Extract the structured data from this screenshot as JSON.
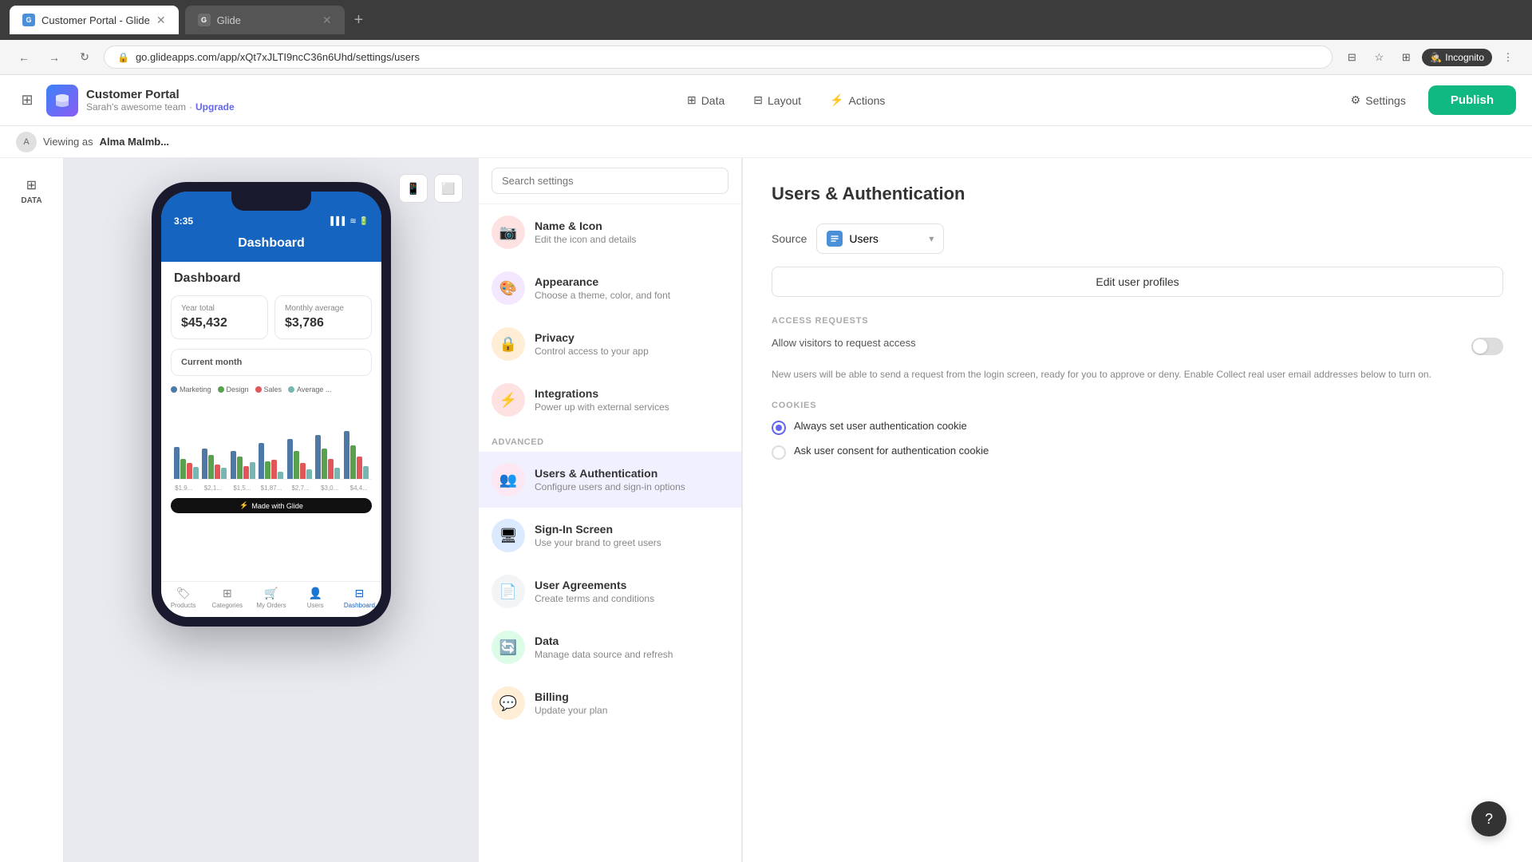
{
  "browser": {
    "tabs": [
      {
        "id": "tab1",
        "title": "Customer Portal - Glide",
        "favicon": "G",
        "active": true
      },
      {
        "id": "tab2",
        "title": "Glide",
        "favicon": "G",
        "active": false
      }
    ],
    "address": "go.glideapps.com/app/xQt7xJLTI9ncC36n6Uhd/settings/users"
  },
  "header": {
    "app_name": "Customer Portal",
    "team_name": "Sarah's awesome team",
    "upgrade_label": "Upgrade",
    "nav": [
      {
        "id": "data",
        "label": "Data",
        "icon": "⊞"
      },
      {
        "id": "layout",
        "label": "Layout",
        "icon": "⊟"
      },
      {
        "id": "actions",
        "label": "Actions",
        "icon": "⚡"
      }
    ],
    "settings_label": "Settings",
    "publish_label": "Publish"
  },
  "viewing_bar": {
    "text": "Viewing as",
    "name": "Alma Malmb..."
  },
  "device_controls": {
    "phone_icon": "📱",
    "tablet_icon": "⬜"
  },
  "phone_preview": {
    "time": "3:35",
    "screen_title": "Dashboard",
    "dashboard_title": "Dashboard",
    "stats": [
      {
        "label": "Year total",
        "value": "$45,432"
      },
      {
        "label": "Monthly average",
        "value": "$3,786"
      }
    ],
    "current_month_label": "Current month",
    "chart_legend": [
      {
        "label": "Marketing",
        "color": "#4e79a7"
      },
      {
        "label": "Design",
        "color": "#59a14f"
      },
      {
        "label": "Sales",
        "color": "#e15759"
      },
      {
        "label": "Average ...",
        "color": "#76b7b2"
      }
    ],
    "bar_data": [
      {
        "label": "$1,9...",
        "bars": [
          40,
          25,
          20,
          15
        ]
      },
      {
        "label": "$2,1...",
        "bars": [
          38,
          30,
          18,
          14
        ]
      },
      {
        "label": "$1,5...",
        "bars": [
          35,
          28,
          16,
          21
        ]
      },
      {
        "label": "$1,87...",
        "bars": [
          45,
          22,
          24,
          9
        ]
      },
      {
        "label": "$2,7...",
        "bars": [
          50,
          35,
          20,
          12
        ]
      },
      {
        "label": "$3,0...",
        "bars": [
          55,
          38,
          25,
          14
        ]
      },
      {
        "label": "$4,4...",
        "bars": [
          60,
          42,
          28,
          16
        ]
      }
    ],
    "bottom_nav": [
      {
        "label": "Products",
        "icon": "🏷",
        "active": false
      },
      {
        "label": "Categories",
        "icon": "⊞",
        "active": false
      },
      {
        "label": "My Orders",
        "icon": "🛒",
        "active": false
      },
      {
        "label": "Users",
        "icon": "👤",
        "active": false
      },
      {
        "label": "Dashboard",
        "icon": "⊟",
        "active": true
      }
    ],
    "made_with_label": "Made with Glide"
  },
  "settings_panel": {
    "search_placeholder": "Search settings",
    "items": [
      {
        "id": "name-icon",
        "title": "Name & Icon",
        "desc": "Edit the icon and details",
        "icon": "📷",
        "color": "#ff6b6b"
      },
      {
        "id": "appearance",
        "title": "Appearance",
        "desc": "Choose a theme, color, and font",
        "icon": "🎨",
        "color": "#c084fc"
      },
      {
        "id": "privacy",
        "title": "Privacy",
        "desc": "Control access to your app",
        "icon": "🔒",
        "color": "#fb923c"
      },
      {
        "id": "integrations",
        "title": "Integrations",
        "desc": "Power up with external services",
        "icon": "⚡",
        "color": "#f87171"
      }
    ],
    "advanced_label": "ADVANCED",
    "advanced_items": [
      {
        "id": "users-auth",
        "title": "Users & Authentication",
        "desc": "Configure users and sign-in options",
        "icon": "👥",
        "color": "#f472b6",
        "active": true
      },
      {
        "id": "sign-in",
        "title": "Sign-In Screen",
        "desc": "Use your brand to greet users",
        "icon": "🖥",
        "color": "#60a5fa"
      },
      {
        "id": "user-agreements",
        "title": "User Agreements",
        "desc": "Create terms and conditions",
        "icon": "📄",
        "color": "#a3a3a3"
      },
      {
        "id": "data",
        "title": "Data",
        "desc": "Manage data source and refresh",
        "icon": "🔄",
        "color": "#4ade80"
      },
      {
        "id": "billing",
        "title": "Billing",
        "desc": "Update your plan",
        "icon": "💬",
        "color": "#fb923c"
      }
    ]
  },
  "right_panel": {
    "title": "Users & Authentication",
    "source_label": "Source",
    "source_value": "Users",
    "edit_profiles_label": "Edit user profiles",
    "access_requests_title": "ACCESS REQUESTS",
    "access_requests_label": "Allow visitors to request access",
    "access_requests_desc": "New users will be able to send a request from the login screen, ready for you to approve or deny. Enable Collect real user email addresses below to turn on.",
    "cookies_title": "COOKIES",
    "cookie_options": [
      {
        "id": "always",
        "label": "Always set user authentication cookie",
        "selected": true
      },
      {
        "id": "ask",
        "label": "Ask user consent for authentication cookie",
        "selected": false
      }
    ]
  },
  "data_sidebar": {
    "label": "DATA"
  },
  "help": {
    "icon": "?"
  }
}
